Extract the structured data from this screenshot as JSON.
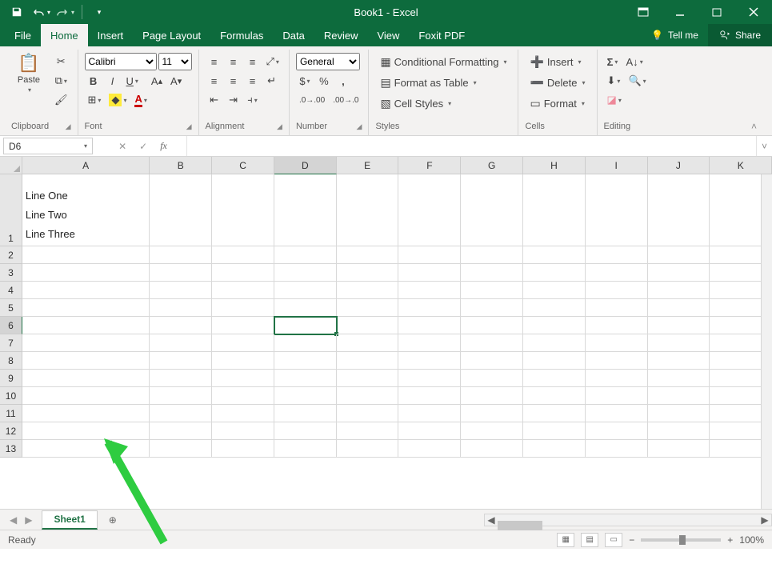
{
  "title": "Book1 - Excel",
  "qat": {
    "save": "save",
    "undo": "undo",
    "redo": "redo"
  },
  "tabs": {
    "file": "File",
    "home": "Home",
    "insert": "Insert",
    "page_layout": "Page Layout",
    "formulas": "Formulas",
    "data": "Data",
    "review": "Review",
    "view": "View",
    "foxit": "Foxit PDF"
  },
  "tellme": "Tell me",
  "share": "Share",
  "ribbon": {
    "clipboard": {
      "paste": "Paste",
      "label": "Clipboard"
    },
    "font": {
      "name": "Calibri",
      "size": "11",
      "label": "Font"
    },
    "alignment": {
      "label": "Alignment"
    },
    "number": {
      "format": "General",
      "label": "Number"
    },
    "styles": {
      "cond": "Conditional Formatting",
      "tbl": "Format as Table",
      "cell": "Cell Styles",
      "label": "Styles"
    },
    "cells": {
      "ins": "Insert",
      "del": "Delete",
      "fmt": "Format",
      "label": "Cells"
    },
    "editing": {
      "label": "Editing"
    }
  },
  "namebox": "D6",
  "columns": [
    "A",
    "B",
    "C",
    "D",
    "E",
    "F",
    "G",
    "H",
    "I",
    "J",
    "K"
  ],
  "rows": [
    "1",
    "2",
    "3",
    "4",
    "5",
    "6",
    "7",
    "8",
    "9",
    "10",
    "11",
    "12",
    "13"
  ],
  "cellA1": {
    "l1": "Line One",
    "l2": "Line Two",
    "l3": "Line Three"
  },
  "sheet": "Sheet1",
  "status": "Ready",
  "zoom": "100%",
  "active": {
    "row": 5,
    "col": 3
  }
}
